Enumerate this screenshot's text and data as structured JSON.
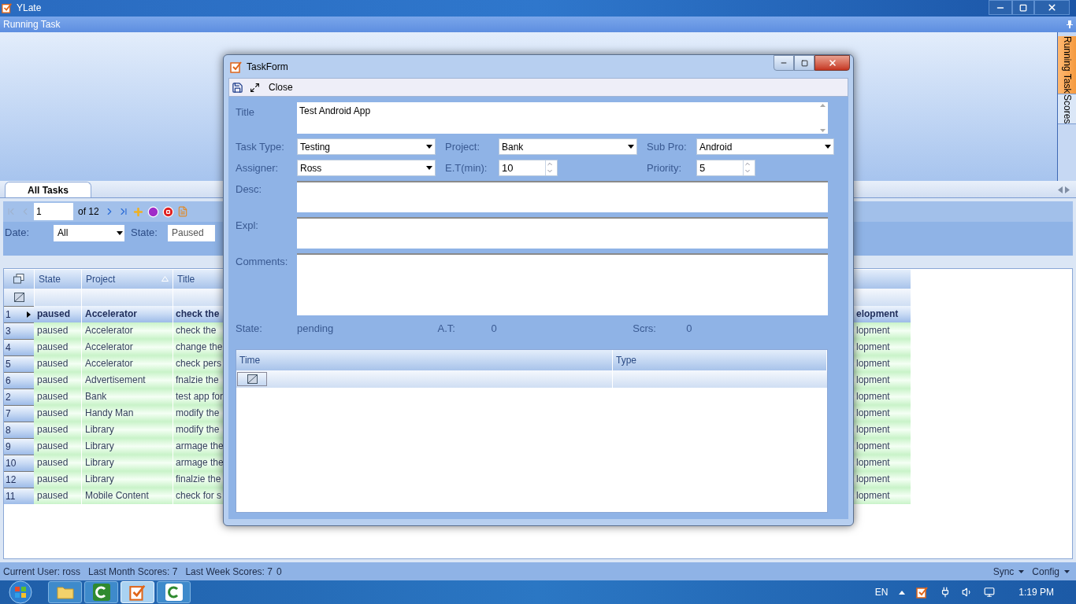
{
  "app": {
    "title": "YLate"
  },
  "panel": {
    "title": "Running Task"
  },
  "side_tabs": [
    {
      "label": "Running Task",
      "selected": true
    },
    {
      "label": "Scores",
      "selected": false
    }
  ],
  "tabs": [
    {
      "label": "All Tasks",
      "selected": true
    }
  ],
  "pager": {
    "page": "1",
    "total": "of 12"
  },
  "filters": [
    {
      "label": "Date:",
      "value": "All",
      "kind": "dropdown"
    },
    {
      "label": "State:",
      "value": "Paused",
      "kind": "text"
    }
  ],
  "grid": {
    "columns": [
      {
        "label": "State",
        "sorted": false
      },
      {
        "label": "Project",
        "sorted": true
      },
      {
        "label": "Title",
        "sorted": false
      }
    ],
    "rows": [
      {
        "number": "1",
        "state": "paused",
        "project": "Accelerator",
        "title": "check the",
        "column_4": "elopment",
        "selected": true
      },
      {
        "number": "3",
        "state": "paused",
        "project": "Accelerator",
        "title": "check the",
        "column_4": "lopment",
        "selected": false
      },
      {
        "number": "4",
        "state": "paused",
        "project": "Accelerator",
        "title": "change the",
        "column_4": "lopment",
        "selected": false
      },
      {
        "number": "5",
        "state": "paused",
        "project": "Accelerator",
        "title": "check pers",
        "column_4": "lopment",
        "selected": false
      },
      {
        "number": "6",
        "state": "paused",
        "project": "Advertisement",
        "title": "fnalzie the",
        "column_4": "lopment",
        "selected": false
      },
      {
        "number": "2",
        "state": "paused",
        "project": "Bank",
        "title": "test app for",
        "column_4": "lopment",
        "selected": false
      },
      {
        "number": "7",
        "state": "paused",
        "project": "Handy Man",
        "title": "modify the",
        "column_4": "lopment",
        "selected": false
      },
      {
        "number": "8",
        "state": "paused",
        "project": "Library",
        "title": "modify the",
        "column_4": "lopment",
        "selected": false
      },
      {
        "number": "9",
        "state": "paused",
        "project": "Library",
        "title": "armage the",
        "column_4": "lopment",
        "selected": false
      },
      {
        "number": "10",
        "state": "paused",
        "project": "Library",
        "title": "armage the",
        "column_4": "lopment",
        "selected": false
      },
      {
        "number": "12",
        "state": "paused",
        "project": "Library",
        "title": "finalzie the",
        "column_4": "lopment",
        "selected": false
      },
      {
        "number": "11",
        "state": "paused",
        "project": "Mobile Content",
        "title": "check for s",
        "column_4": "lopment",
        "selected": false
      }
    ]
  },
  "dialog": {
    "title": "TaskForm",
    "toolbar": {
      "close": "Close"
    },
    "title_field": {
      "label": "Title",
      "value": "Test Android App"
    },
    "field_rows": [
      [
        {
          "label": "Task Type:",
          "value": "Testing",
          "kind": "dropdown"
        },
        {
          "label": "Project:",
          "value": "Bank",
          "kind": "dropdown"
        },
        {
          "label": "Sub Pro:",
          "value": "Android",
          "kind": "dropdown"
        }
      ],
      [
        {
          "label": "Assigner:",
          "value": "Ross",
          "kind": "dropdown"
        },
        {
          "label": "E.T(min):",
          "value": "10",
          "kind": "spinner"
        },
        {
          "label": "Priority:",
          "value": "5",
          "kind": "spinner"
        }
      ]
    ],
    "notes": [
      {
        "label": "Desc:"
      },
      {
        "label": "Expl:"
      },
      {
        "label": "Comments:"
      }
    ],
    "info": [
      {
        "label": "State:",
        "value": "pending"
      },
      {
        "label": "A.T:",
        "value": "0"
      },
      {
        "label": "Scrs:",
        "value": "0"
      }
    ],
    "log_grid": {
      "columns": [
        "Time",
        "Type"
      ]
    }
  },
  "status_bar": {
    "items": [
      "Current User: ross",
      "Last Month Scores: 7",
      "Last Week Scores: 7",
      "0"
    ],
    "menus": [
      "Sync",
      "Config"
    ]
  },
  "taskbar": {
    "apps": [
      {
        "kind": "folder",
        "selected": false
      },
      {
        "kind": "green-c",
        "selected": false
      },
      {
        "kind": "ylate",
        "selected": true
      },
      {
        "kind": "white-c",
        "selected": false
      }
    ],
    "tray": {
      "language": "EN",
      "time": "1:19 PM"
    }
  }
}
